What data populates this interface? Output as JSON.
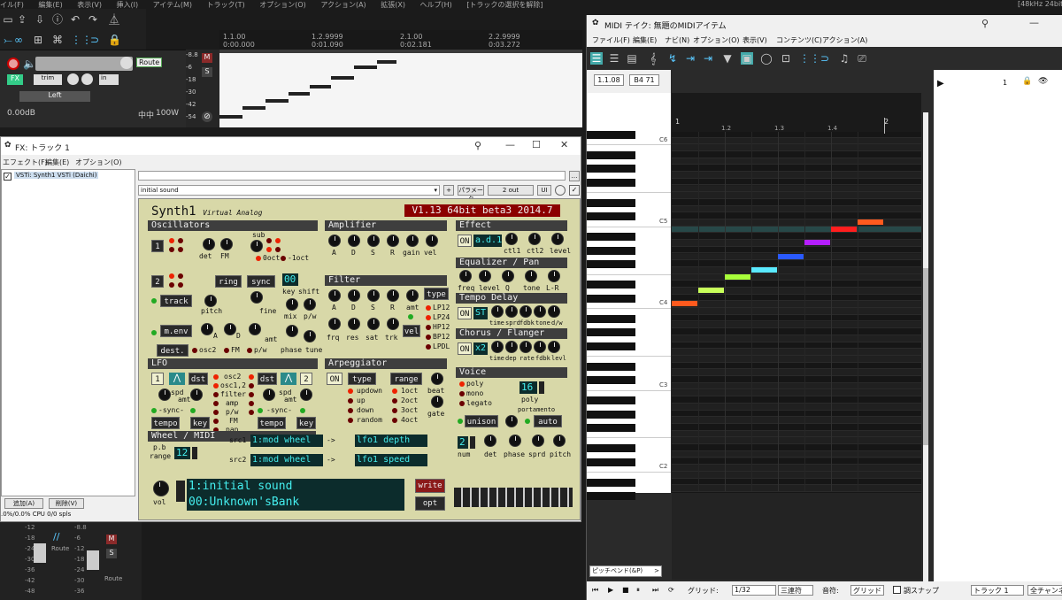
{
  "menubar": {
    "items": [
      "イル(F)",
      "編集(E)",
      "表示(V)",
      "挿入(I)",
      "アイテム(M)",
      "トラック(T)",
      "オプション(O)",
      "アクション(A)",
      "拡張(X)",
      "ヘルプ(H)",
      "[トラックの選択を解除]"
    ],
    "right": "[48kHz 24bit"
  },
  "track": {
    "volume_db": "0.00dB",
    "pan": "中中",
    "width": "100W",
    "route_label": "Route",
    "fx_label": "FX",
    "trim_label": "trim",
    "in_label": "in",
    "input_select": "Left",
    "meter_marks": [
      "-8.8",
      "-6",
      "-18",
      "-30",
      "-42",
      "-54"
    ],
    "m": "M",
    "s": "S"
  },
  "timeline": {
    "marks": [
      {
        "bar": "1.1.00",
        "time": "0:00.000"
      },
      {
        "bar": "1.2.9999",
        "time": "0:01.090"
      },
      {
        "bar": "2.1.00",
        "time": "0:02.181"
      },
      {
        "bar": "2.2.9999",
        "time": "0:03.272"
      }
    ]
  },
  "fx_window": {
    "title": "FX: トラック 1",
    "menu": [
      "エフェクト(F)",
      "編集(E)",
      "オプション(O)"
    ],
    "plugin_entry": "VSTi: Synth1 VSTi (Daichi)",
    "preset": "initial sound",
    "param_label": "パラメータ",
    "out_label": "2 out",
    "ui_label": "UI",
    "plus": "+",
    "add_button": "追加(A)",
    "remove_button": "削除(V)",
    "cpu": ".0%/0.0% CPU 0/0 spls"
  },
  "synth": {
    "title": "Synth1",
    "subtitle": "Virtual Analog",
    "version": "V1.13 64bit beta3 2014.7",
    "sections": {
      "oscillators": "Oscillators",
      "amplifier": "Amplifier",
      "effect": "Effect",
      "equalizer": "Equalizer / Pan",
      "tempo_delay": "Tempo Delay",
      "chorus": "Chorus / Flanger",
      "filter": "Filter",
      "lfo": "LFO",
      "arpeggiator": "Arpeggiator",
      "voice": "Voice",
      "wheel": "Wheel / MIDI"
    },
    "labels": {
      "det": "det",
      "fm": "FM",
      "sub": "sub",
      "oct0": "0oct",
      "oct1": "-1oct",
      "ring": "ring",
      "sync": "sync",
      "track": "track",
      "pitch": "pitch",
      "fine": "fine",
      "key": "key",
      "shift": "shift",
      "mix": "mix",
      "pw": "p/w",
      "menv": "m.env",
      "dest": "dest.",
      "osc2": "osc2",
      "a": "A",
      "d": "D",
      "s": "S",
      "r": "R",
      "amt": "amt",
      "phase": "phase",
      "tune": "tune",
      "gain": "gain",
      "vel": "vel",
      "frq": "frq",
      "res": "res",
      "sat": "sat",
      "trk": "trk",
      "type": "type",
      "lp12": "LP12",
      "lp24": "LP24",
      "hp12": "HP12",
      "bp12": "BP12",
      "lpdl": "LPDL",
      "on": "ON",
      "ctl1": "ctl1",
      "ctl2": "ctl2",
      "level": "level",
      "freq": "freq",
      "q": "Q",
      "tone": "tone",
      "lr": "L-R",
      "time": "time",
      "sprd": "sprd",
      "fdbk": "fdbk",
      "tonedw": "tone",
      "dw": "d/w",
      "dph": "dep",
      "rate": "rate",
      "lvl": "levl",
      "poly": "poly",
      "mono": "mono",
      "legato": "legato",
      "unison": "unison",
      "portamento": "portamento",
      "auto": "auto",
      "num": "num",
      "range": "range",
      "updown": "updown",
      "up": "up",
      "down": "down",
      "random": "random",
      "oct1x": "1oct",
      "oct2": "2oct",
      "oct3": "3oct",
      "oct4": "4oct",
      "beat": "beat",
      "gate": "gate",
      "dst": "dst",
      "spd": "spd",
      "syncl": "-sync-",
      "tempo": "tempo",
      "osc12": "osc1,2",
      "filter": "filter",
      "amp": "amp",
      "pan": "pan",
      "osc2l": "osc2",
      "pb": "p.b",
      "pbrange": "range",
      "src1": "src1",
      "src2": "src2",
      "vol": "vol",
      "write": "write",
      "opt": "opt"
    },
    "values": {
      "effect_type": "a.d.1",
      "delay_type": "ST",
      "chorus_type": "x2",
      "key_shift": "00",
      "poly": "16",
      "unison_num": "2",
      "pb_range": "12",
      "osc1": "1",
      "osc2": "2",
      "lfo1": "1",
      "lfo2": "2"
    },
    "wheel": {
      "src1": "1:mod wheel",
      "dst1": "lfo1 depth",
      "src2": "1:mod wheel",
      "dst2": "lfo1 speed"
    },
    "patch": {
      "name": "1:initial sound",
      "bank": "00:Unknown'sBank"
    }
  },
  "midi_editor": {
    "title": "MIDI テイク: 無題のMIDIアイテム",
    "menu": [
      "ファイル(F)",
      "編集(E)",
      "ナビ(N)",
      "オプション(O)",
      "表示(V)",
      "コンテンツ(C)",
      "アクション(A)"
    ],
    "position": "1.1.08",
    "note_readout": "B4  71",
    "ruler": [
      "1",
      "1.2",
      "1.3",
      "1.4",
      "2"
    ],
    "key_labels": [
      "C6",
      "C5",
      "C4",
      "C3",
      "C2"
    ],
    "cc_lane": "ピッチベンド(&P)",
    "track_number": "1",
    "bottom": {
      "grid_label": "グリッド:",
      "grid_value": "1/32",
      "triplet": "三連符",
      "note_label": "音符:",
      "note_value": "グリッド",
      "snap": "調スナップ",
      "track": "トラック 1",
      "channel": "全チャンネル"
    },
    "notes": [
      {
        "pitch": 60,
        "color": "#ff5a1e"
      },
      {
        "pitch": 62,
        "color": "#c8ff5a"
      },
      {
        "pitch": 64,
        "color": "#a8ff3a"
      },
      {
        "pitch": 65,
        "color": "#5aeaff"
      },
      {
        "pitch": 67,
        "color": "#2a5aff"
      },
      {
        "pitch": 69,
        "color": "#b41eff"
      },
      {
        "pitch": 71,
        "color": "#ff1e1e"
      },
      {
        "pitch": 72,
        "color": "#ff5a1e"
      }
    ]
  },
  "mixer": {
    "marks": [
      "-12",
      "-18",
      "-24",
      "-30",
      "-36",
      "-42",
      "-48"
    ],
    "route": "Route",
    "m": "M",
    "s": "S",
    "marks2": [
      "-8.8",
      "-6",
      "-12",
      "-18",
      "-24",
      "-30",
      "-36",
      "-42"
    ]
  }
}
